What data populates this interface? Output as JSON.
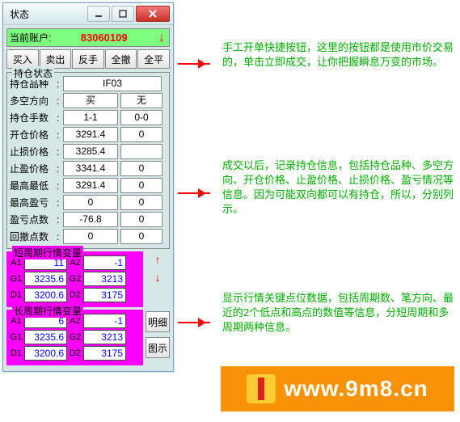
{
  "window": {
    "title": "状态"
  },
  "account": {
    "label": "当前账户:",
    "value": "83060109"
  },
  "buttons": {
    "buy": "买入",
    "sell": "卖出",
    "reverse": "反手",
    "cancelAll": "全撤",
    "closeAll": "全平"
  },
  "position": {
    "groupLabel": "持仓状态",
    "rows": {
      "symbol": {
        "label": "持仓品种",
        "v1": "IF03"
      },
      "direction": {
        "label": "多空方向",
        "v1": "买",
        "v2": "无"
      },
      "lots": {
        "label": "持仓手数",
        "v1": "1-1",
        "v2": "0-0"
      },
      "openPrice": {
        "label": "开仓价格",
        "v1": "3291.4",
        "v2": "0"
      },
      "stopPrice": {
        "label": "止损价格",
        "v1": "3285.4",
        "v2": ""
      },
      "profitPrice": {
        "label": "止盈价格",
        "v1": "3341.4",
        "v2": "0"
      },
      "hiLo": {
        "label": "最高最低",
        "v1": "3291.4",
        "v2": "0"
      },
      "maxPL": {
        "label": "最高盈亏",
        "v1": "0",
        "v2": "0"
      },
      "plPoints": {
        "label": "盈亏点数",
        "v1": "-76.8",
        "v2": "0"
      },
      "ddPoints": {
        "label": "回撤点数",
        "v1": "0",
        "v2": "0"
      }
    }
  },
  "shortCycle": {
    "label": "短周期行情变量",
    "A1": "11",
    "A2": "-1",
    "G1": "3235.6",
    "G2": "3213",
    "D1": "3200.6",
    "D2": "3175"
  },
  "longCycle": {
    "label": "长周期行情变量",
    "A1": "6",
    "A2": "-1",
    "G1": "3235.6",
    "G2": "3213",
    "D1": "3200.6",
    "D2": "3175"
  },
  "sideButtons": {
    "detail": "明细",
    "chart": "图示"
  },
  "annotations": {
    "a1": "手工开单快捷按钮，这里的按钮都是使用市价交易的，单击立即成交，让你把握瞬息万变的市场。",
    "a2": "成交以后，记录持仓信息，包括持仓品种、多空方向、开仓价格、止盈价格、止损价格、盈亏情况等信息。因为可能双向都可以有持仓，所以，分别列示。",
    "a3": "显示行情关键点位数据，包括周期数、笔方向、最近的2个低点和高点的数值等信息，分短周期和多周期两种信息。"
  },
  "banner": {
    "text": "www.9m8.cn"
  }
}
